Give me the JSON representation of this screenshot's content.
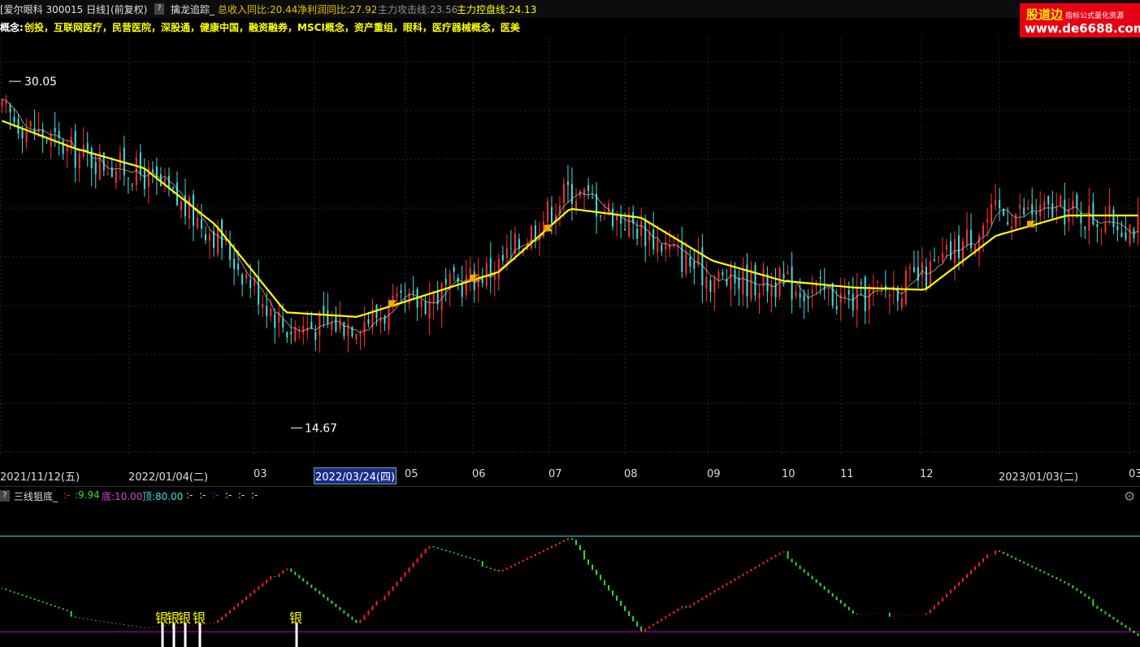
{
  "header": {
    "stock": "[爱尔眼科 300015 日线]",
    "adjust": "(前复权)",
    "help": "?",
    "indicator_name": "擒龙追踪_",
    "revenue_label": "总收入同比:20.44",
    "profit_label": "净利润同比:27.92",
    "attack_label": "主力攻击线:23.56",
    "control_label": "主力控盘线:24.13",
    "colors": {
      "revenue": "#e6c200",
      "profit": "#e6c200",
      "attack": "#909090",
      "control": "#ffff00"
    }
  },
  "concepts": {
    "prefix": "概念:",
    "text": "创投，互联网医疗，民营医院，深股通，健康中国，融资融券，MSCI概念，资产重组，眼科，医疗器械概念，医美"
  },
  "watermark": {
    "brand": "股道边",
    "tagline": "指标公式量化资源",
    "url": "www.de6688.com"
  },
  "date_axis": [
    {
      "label": "2021/11/12(五)",
      "selected": false
    },
    {
      "label": "2022/01/04(二)",
      "selected": false
    },
    {
      "label": "03",
      "selected": false
    },
    {
      "label": "2022/03/24(四)",
      "selected": true
    },
    {
      "label": "05",
      "selected": false
    },
    {
      "label": "06",
      "selected": false
    },
    {
      "label": "07",
      "selected": false
    },
    {
      "label": "08",
      "selected": false
    },
    {
      "label": "09",
      "selected": false
    },
    {
      "label": "10",
      "selected": false
    },
    {
      "label": "11",
      "selected": false
    },
    {
      "label": "12",
      "selected": false
    },
    {
      "label": "2023/01/03(二)",
      "selected": false
    },
    {
      "label": "03",
      "selected": false
    }
  ],
  "indicator_panel": {
    "help": "?",
    "name": "三线狙底_",
    "v1": ":-",
    "v2": ":9.94",
    "bottom": "底:10.00",
    "top": "顶:80.00",
    "tail1": ":-",
    "tail2": ":-",
    "tail3": ":-",
    "tail4": ":-",
    "tail5": ":-",
    "tail6": ":-"
  },
  "chart_data": [
    {
      "type": "candlestick",
      "title": "",
      "xlabel": "",
      "ylabel": "",
      "ylim": [
        13.5,
        32.0
      ],
      "grid": true,
      "colors": {
        "up": "#ff3030",
        "down": "#40e0e0",
        "main_line": "#ffff00",
        "fast_line": "#c8c8c8",
        "flag": "#ffa500"
      },
      "x": [
        "2021-11",
        "2021-12",
        "2022-01",
        "2022-02",
        "2022-03",
        "2022-04",
        "2022-05",
        "2022-06",
        "2022-07",
        "2022-08",
        "2022-09",
        "2022-10",
        "2022-11",
        "2022-12",
        "2023-01",
        "2023-02",
        "2023-03"
      ],
      "series": [
        {
          "name": "",
          "values": [
            28.7,
            26.9,
            25.9,
            23.3,
            19.1,
            19.4,
            20.4,
            21.9,
            25.3,
            23.5,
            21.3,
            21.1,
            20.3,
            21.4,
            24.2,
            24.3,
            23.6
          ]
        },
        {
          "name": "",
          "values": [
            28.3,
            27.1,
            26.2,
            23.7,
            19.8,
            19.6,
            20.6,
            21.6,
            24.4,
            24.0,
            22.1,
            21.2,
            20.9,
            20.8,
            23.2,
            24.1,
            24.1
          ]
        }
      ],
      "annotations": [
        {
          "text": "30.05",
          "value": 30.05
        },
        {
          "text": "14.67",
          "value": 14.67
        }
      ],
      "flag_dates": [
        "2022-04-12",
        "2022-05-27",
        "2022-06-30",
        "2023-01-12"
      ]
    },
    {
      "type": "line",
      "title": "",
      "ylim": [
        0,
        100
      ],
      "x": [
        "2021-11",
        "2021-12",
        "2022-01",
        "2022-02",
        "2022-03",
        "2022-04",
        "2022-05",
        "2022-06",
        "2022-07",
        "2022-08",
        "2022-09",
        "2022-10",
        "2022-11",
        "2022-12",
        "2023-01",
        "2023-02",
        "2023-03"
      ],
      "series": [
        {
          "name": "",
          "values": [
            42,
            22,
            12,
            17,
            58,
            15,
            73,
            55,
            78,
            10,
            40,
            68,
            22,
            23,
            71,
            44,
            7
          ]
        }
      ],
      "reference_lines": [
        {
          "name": "顶",
          "value": 80,
          "color": "#40e0e0"
        },
        {
          "name": "底",
          "value": 10,
          "color": "#c000c0"
        }
      ],
      "markers": [
        {
          "text": "银",
          "date": "2022-01-10"
        },
        {
          "text": "银",
          "date": "2022-01-13"
        },
        {
          "text": "银",
          "date": "2022-01-17"
        },
        {
          "text": "银",
          "date": "2022-01-21"
        },
        {
          "text": "银",
          "date": "2022-03-17"
        }
      ]
    }
  ]
}
